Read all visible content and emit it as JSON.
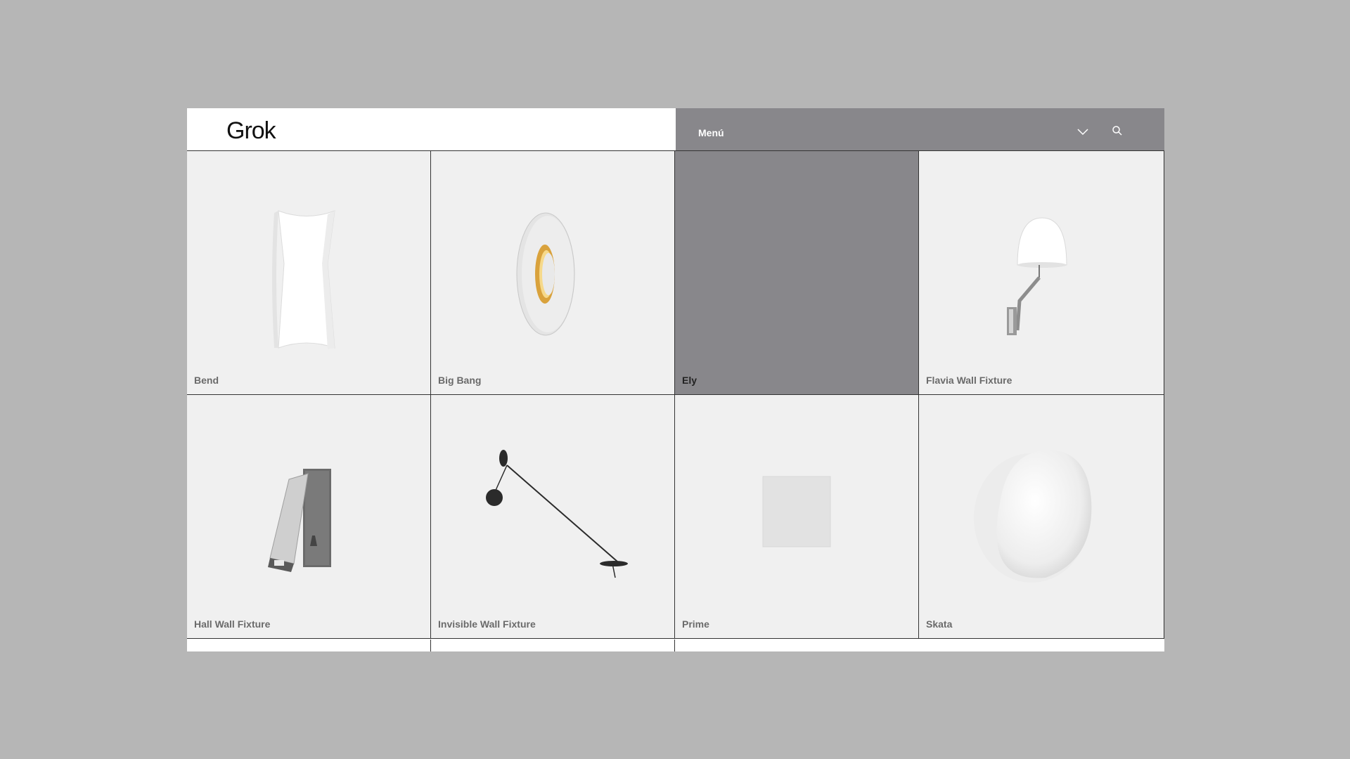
{
  "header": {
    "logo": "Grok",
    "menu_label": "Menú",
    "dropdown_icon": "chevron-down-icon",
    "search_icon": "search-icon"
  },
  "colors": {
    "page_background": "#b6b6b6",
    "menu_bar": "#88878b",
    "tile_background": "#f0f0f0",
    "highlight_tile": "#88878b"
  },
  "products": [
    {
      "label": "Bend"
    },
    {
      "label": "Big Bang"
    },
    {
      "label": "Ely"
    },
    {
      "label": "Flavia Wall Fixture"
    },
    {
      "label": "Hall Wall Fixture"
    },
    {
      "label": "Invisible Wall Fixture"
    },
    {
      "label": "Prime"
    },
    {
      "label": "Skata"
    }
  ]
}
